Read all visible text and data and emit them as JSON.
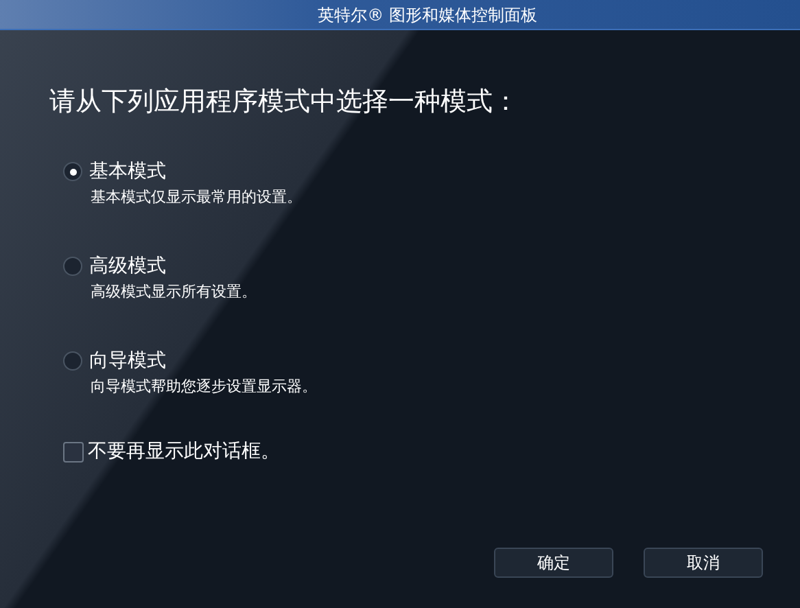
{
  "window": {
    "title": "英特尔® 图形和媒体控制面板"
  },
  "heading": "请从下列应用程序模式中选择一种模式：",
  "modes": [
    {
      "label": "基本模式",
      "description": "基本模式仅显示最常用的设置。",
      "selected": true
    },
    {
      "label": "高级模式",
      "description": "高级模式显示所有设置。",
      "selected": false
    },
    {
      "label": "向导模式",
      "description": "向导模式帮助您逐步设置显示器。",
      "selected": false
    }
  ],
  "dont_show_again": {
    "label": "不要再显示此对话框。",
    "checked": false
  },
  "buttons": [
    "确定",
    "取消"
  ]
}
